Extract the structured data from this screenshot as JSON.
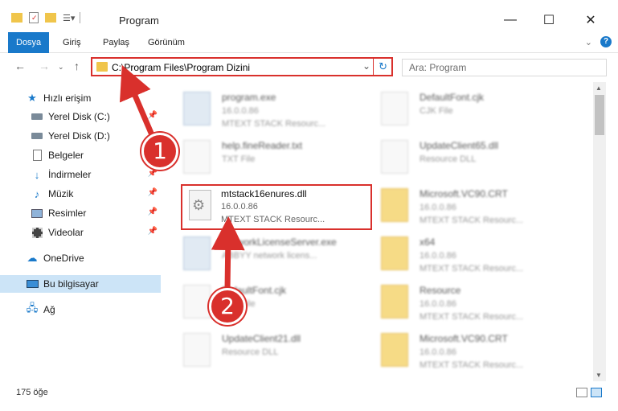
{
  "window": {
    "title": "Program",
    "buttons": {
      "minimize": "—",
      "maximize": "☐",
      "close": "✕"
    }
  },
  "ribbon": {
    "tabs": [
      {
        "label": "Dosya",
        "active": true
      },
      {
        "label": "Giriş"
      },
      {
        "label": "Paylaş"
      },
      {
        "label": "Görünüm"
      }
    ]
  },
  "address": {
    "path": "C:\\Program Files\\Program Dizini",
    "search_placeholder": "Ara: Program"
  },
  "sidebar": {
    "items": [
      {
        "label": "Hızlı erişim",
        "icon": "star-icon"
      },
      {
        "label": "Yerel Disk (C:)",
        "icon": "drive-icon",
        "pinned": true
      },
      {
        "label": "Yerel Disk (D:)",
        "icon": "drive-icon"
      },
      {
        "label": "Belgeler",
        "icon": "document-icon"
      },
      {
        "label": "İndirmeler",
        "icon": "download-icon",
        "pinned": true
      },
      {
        "label": "Müzik",
        "icon": "music-icon",
        "pinned": true
      },
      {
        "label": "Resimler",
        "icon": "picture-icon",
        "pinned": true
      },
      {
        "label": "Videolar",
        "icon": "video-icon",
        "pinned": true
      },
      {
        "label": "OneDrive",
        "icon": "cloud-icon"
      },
      {
        "label": "Bu bilgisayar",
        "icon": "computer-icon",
        "selected": true
      },
      {
        "label": "Ağ",
        "icon": "network-icon"
      }
    ]
  },
  "files": {
    "left": [
      {
        "name": "program.exe",
        "meta1": "16.0.0.86",
        "meta2": "MTEXT STACK Resourc..."
      },
      {
        "name": "help.fineReader.txt",
        "meta1": "TXT File",
        "meta2": ""
      },
      {
        "name": "mtstack16enures.dll",
        "meta1": "16.0.0.86",
        "meta2": "MTEXT STACK Resourc..."
      },
      {
        "name": "NetworkLicenseServer.exe",
        "meta1": "ABBYY network licens...",
        "meta2": ""
      },
      {
        "name": "DefaultFont.cjk",
        "meta1": "CJK File",
        "meta2": ""
      },
      {
        "name": "UpdateClient21.dll",
        "meta1": "Resource DLL",
        "meta2": ""
      }
    ],
    "right": [
      {
        "name": "DefaultFont.cjk",
        "meta1": "CJK File",
        "meta2": ""
      },
      {
        "name": "UpdateClient65.dll",
        "meta1": "Resource DLL",
        "meta2": ""
      },
      {
        "name": "Microsoft.VC90.CRT",
        "meta1": "16.0.0.86",
        "meta2": "MTEXT STACK Resourc..."
      },
      {
        "name": "x64",
        "meta1": "16.0.0.86",
        "meta2": "MTEXT STACK Resourc..."
      },
      {
        "name": "Resource",
        "meta1": "16.0.0.86",
        "meta2": "MTEXT STACK Resourc..."
      },
      {
        "name": "Microsoft.VC90.CRT",
        "meta1": "16.0.0.86",
        "meta2": "MTEXT STACK Resourc..."
      }
    ]
  },
  "status": {
    "count": "175 öğe"
  },
  "annotations": {
    "step1": "1",
    "step2": "2"
  },
  "colors": {
    "accent": "#1979ca",
    "highlight": "#d9302c"
  }
}
